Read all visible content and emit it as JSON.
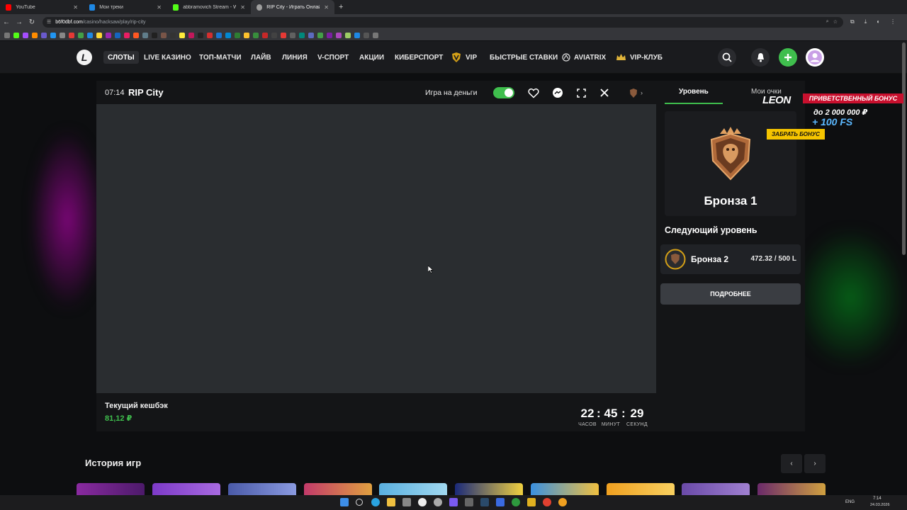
{
  "browser": {
    "tabs": [
      {
        "title": "YouTube",
        "icon": "youtube-icon",
        "color": "#ff0000",
        "active": false
      },
      {
        "title": "Мои треки",
        "icon": "music-icon",
        "color": "#1e88e5",
        "active": false
      },
      {
        "title": "abbramovich Stream - Watch Li",
        "icon": "kick-icon",
        "color": "#53fc18",
        "active": false
      },
      {
        "title": "RIP City - Играть Онлайн | ЛЕО",
        "icon": "leon-icon",
        "color": "#9e9e9e",
        "active": true
      }
    ],
    "url_host": "b6f0dbf.com",
    "url_path": "/casino/hacksaw/play/rip-city"
  },
  "header": {
    "logo": "L",
    "nav": [
      {
        "label": "СЛОТЫ",
        "active": true
      },
      {
        "label": "LIVE КАЗИНО"
      },
      {
        "label": "ТОП-МАТЧИ"
      },
      {
        "label": "ЛАЙВ"
      },
      {
        "label": "ЛИНИЯ"
      },
      {
        "label": "V-СПОРТ"
      },
      {
        "label": "АКЦИИ"
      },
      {
        "label": "КИБЕРСПОРТ"
      },
      {
        "label": "VIP"
      },
      {
        "label": "БЫСТРЫЕ СТАВКИ"
      },
      {
        "label": "AVIATRIX"
      },
      {
        "label": "VIP-КЛУБ"
      }
    ],
    "accent": "#3fbe4d"
  },
  "game": {
    "time": "07:14",
    "title": "RIP City",
    "real_money_label": "Игра на деньги",
    "real_money_on": true
  },
  "side": {
    "tab_level": "Уровень",
    "tab_points": "Мои очки",
    "level_name": "Бронза 1",
    "next_level_title": "Следующий уровень",
    "next_level_name": "Бронза 2",
    "next_level_progress": "472.32 / 500 L",
    "more_button": "ПОДРОБНЕЕ"
  },
  "cashback": {
    "label": "Текущий кешбэк",
    "value": "81,12 ₽"
  },
  "timer": {
    "hours": "22",
    "minutes": "45",
    "seconds": "29",
    "hours_label": "ЧАСОВ",
    "minutes_label": "МИНУТ",
    "seconds_label": "СЕКУНД"
  },
  "promo": {
    "brand": "LEON",
    "title": "ПРИВЕТСТВЕННЫЙ БОНУС",
    "amount": "до 2 000 000 ₽",
    "fs": "+ 100 FS",
    "button": "ЗАБРАТЬ БОНУС"
  },
  "history": {
    "title": "История игр",
    "prev": "‹",
    "next": "›"
  },
  "taskbar": {
    "lang": "ENG",
    "time": "7:14",
    "date": "24.03.2026"
  }
}
